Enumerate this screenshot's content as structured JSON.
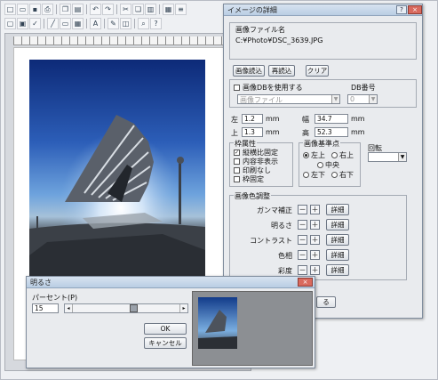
{
  "toolbar": {
    "row1_icons": [
      "new-icon",
      "open-icon",
      "save-icon",
      "print-icon",
      "sep",
      "copy-icon",
      "paste-icon",
      "sep",
      "undo-icon",
      "redo-icon",
      "sep",
      "cut-icon",
      "copy2-icon",
      "paste2-icon",
      "sep",
      "grid-icon",
      "align-icon"
    ],
    "row2_icons": [
      "frame-icon",
      "box-icon",
      "check-icon",
      "sep",
      "line-icon",
      "rect-icon",
      "table-icon",
      "sep",
      "text-icon",
      "sep",
      "pen-icon",
      "eraser-icon",
      "sep",
      "zoom-icon",
      "help-icon"
    ]
  },
  "image_dialog": {
    "title": "イメージの詳細",
    "file_group_label": "画像ファイル名",
    "file_path": "C:¥Photo¥DSC_3639.JPG",
    "buttons": {
      "load": "画像読込",
      "reload": "再読込",
      "clear": "クリア"
    },
    "use_db_label": "画像DBを使用する",
    "db_no_label": "DB番号",
    "db_select_value": "画像ファイル",
    "db_no_value": "0",
    "pos": {
      "left_label": "左",
      "left_value": "1.2",
      "top_label": "上",
      "top_value": "1.3",
      "width_label": "幅",
      "width_value": "34.7",
      "height_label": "高",
      "height_value": "52.3",
      "unit": "mm"
    },
    "frame_attr": {
      "title": "枠属性",
      "items": [
        {
          "label": "縦横比固定",
          "checked": true
        },
        {
          "label": "内容非表示",
          "checked": false
        },
        {
          "label": "印刷なし",
          "checked": false
        },
        {
          "label": "枠固定",
          "checked": false
        }
      ]
    },
    "anchor": {
      "title": "画像基準点",
      "top_left": "左上",
      "top_right": "右上",
      "center": "中央",
      "bottom_left": "左下",
      "bottom_right": "右下",
      "selected": "左上"
    },
    "rotation": {
      "label": "回転",
      "value": ""
    },
    "color": {
      "title": "画像色調整",
      "rows": [
        {
          "label": "ガンマ補正",
          "detail": "詳細"
        },
        {
          "label": "明るさ",
          "detail": "詳細"
        },
        {
          "label": "コントラスト",
          "detail": "詳細"
        },
        {
          "label": "色相",
          "detail": "詳細"
        },
        {
          "label": "彩度",
          "detail": "詳細"
        }
      ],
      "minus": "－",
      "plus": "＋"
    },
    "partial_button": "る"
  },
  "brightness_dialog": {
    "title": "明るさ",
    "percent_label": "パーセント(P)",
    "percent_value": "15",
    "ok": "OK",
    "cancel": "キャンセル",
    "slider_fraction": 0.58
  }
}
